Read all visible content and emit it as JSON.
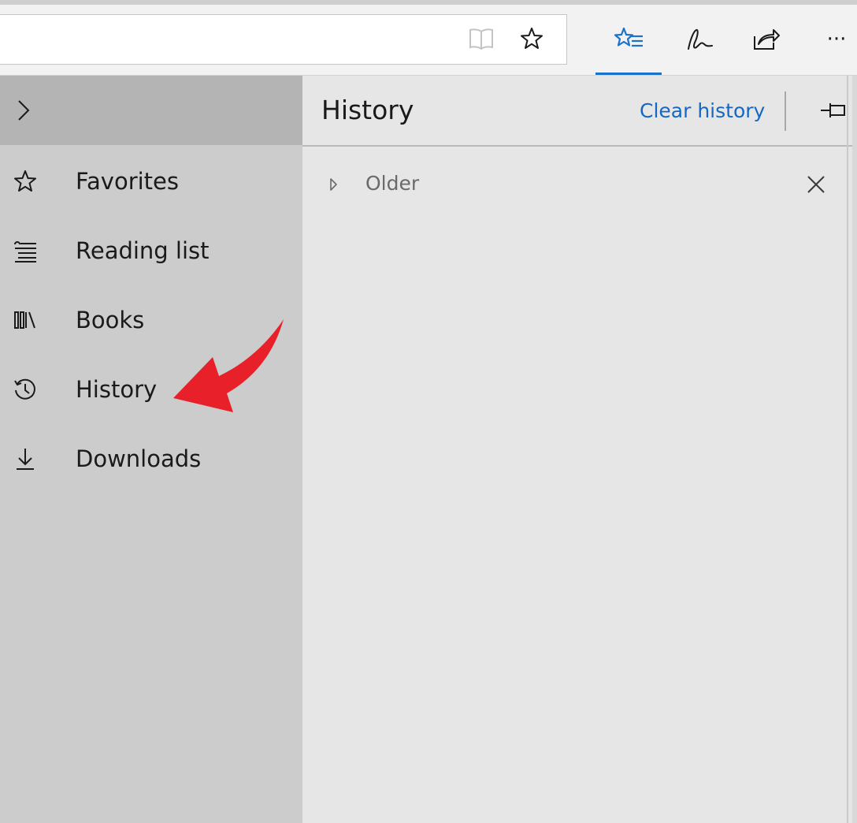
{
  "toolbar": {
    "icons": [
      "reading-view-icon",
      "favorite-star-icon",
      "hub-icon",
      "web-note-icon",
      "share-icon",
      "more-icon"
    ],
    "more_label": "···",
    "accent_color": "#1b73c9"
  },
  "sidebar": {
    "expand_icon": "chevron-right-icon",
    "items": [
      {
        "label": "Favorites",
        "icon": "star-icon"
      },
      {
        "label": "Reading list",
        "icon": "reading-list-icon"
      },
      {
        "label": "Books",
        "icon": "books-icon"
      },
      {
        "label": "History",
        "icon": "history-icon"
      },
      {
        "label": "Downloads",
        "icon": "download-icon"
      }
    ]
  },
  "panel": {
    "title": "History",
    "clear_label": "Clear history",
    "clear_color": "#1567c4",
    "pin_icon": "pin-icon",
    "groups": [
      {
        "label": "Older",
        "expanded": false
      }
    ]
  },
  "annotation": {
    "arrow_color": "#e8202a",
    "points_to": "History"
  }
}
